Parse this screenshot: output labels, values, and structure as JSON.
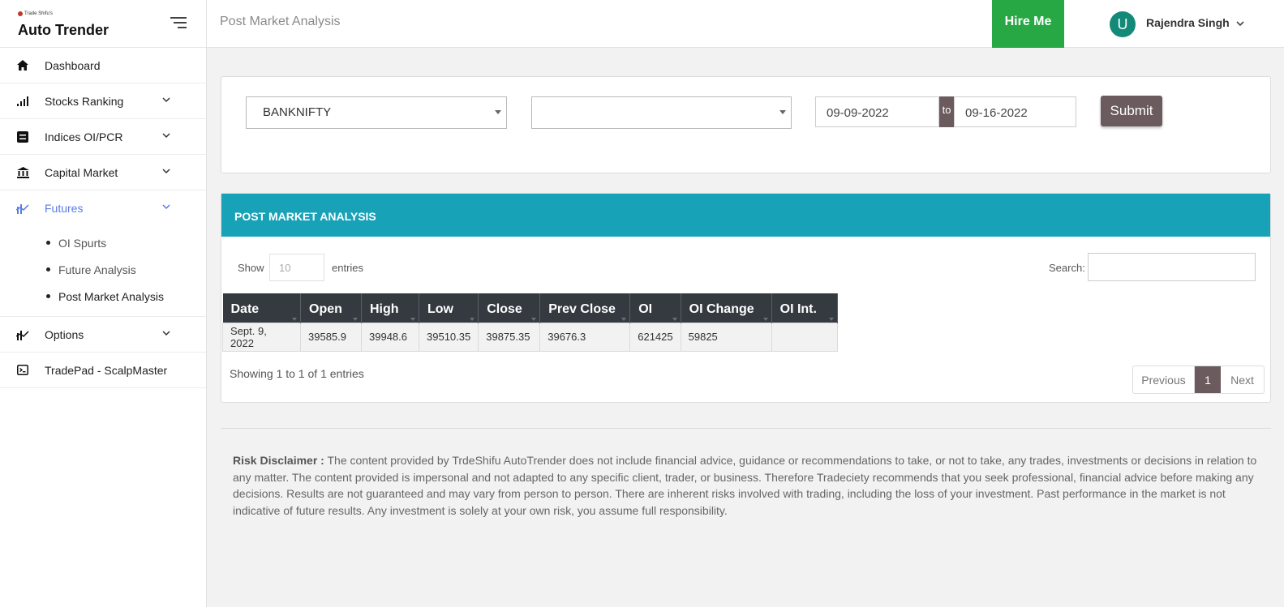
{
  "brand": {
    "small": "Trade Shifu's",
    "name": "Auto Trender"
  },
  "sidebar": {
    "items": [
      {
        "label": "Dashboard"
      },
      {
        "label": "Stocks Ranking"
      },
      {
        "label": "Indices OI/PCR"
      },
      {
        "label": "Capital Market"
      },
      {
        "label": "Futures"
      },
      {
        "label": "Options"
      },
      {
        "label": "TradePad - ScalpMaster"
      }
    ],
    "futures_sub": [
      "OI Spurts",
      "Future Analysis",
      "Post Market Analysis"
    ]
  },
  "header": {
    "title": "Post Market Analysis",
    "hire_label": "Hire Me",
    "avatar_letter": "U",
    "user_name": "Rajendra Singh"
  },
  "filters": {
    "symbol": "BANKNIFTY",
    "second": "",
    "from_date": "09-09-2022",
    "to_label": "to",
    "to_date": "09-16-2022",
    "submit_label": "Submit"
  },
  "table_card": {
    "title": "POST MARKET ANALYSIS",
    "show_label": "Show",
    "show_placeholder": "10",
    "entries_label": "entries",
    "search_label": "Search:",
    "columns": [
      "Date",
      "Open",
      "High",
      "Low",
      "Close",
      "Prev Close",
      "OI",
      "OI Change",
      "OI Int."
    ],
    "rows": [
      [
        "Sept. 9, 2022",
        "39585.9",
        "39948.6",
        "39510.35",
        "39875.35",
        "39676.3",
        "621425",
        "59825",
        ""
      ]
    ],
    "info": "Showing 1 to 1 of 1 entries",
    "prev_label": "Previous",
    "page": "1",
    "next_label": "Next"
  },
  "disclaimer": {
    "title": "Risk Disclaimer :",
    "text": " The content provided by TrdeShifu AutoTrender does not include financial advice, guidance or recommendations to take, or not to take, any trades, investments or decisions in relation to any matter. The content provided is impersonal and not adapted to any specific client, trader, or business. Therefore Tradeciety recommends that you seek professional, financial advice before making any decisions. Results are not guaranteed and may vary from person to person. There are inherent risks involved with trading, including the loss of your investment. Past performance in the market is not indicative of future results. Any investment is solely at your own risk, you assume full responsibility."
  },
  "colors": {
    "accent": "#5b7be6",
    "hire": "#27a844",
    "card_header": "#18a2b8",
    "button": "#6b5b5f",
    "avatar": "#138a77"
  }
}
